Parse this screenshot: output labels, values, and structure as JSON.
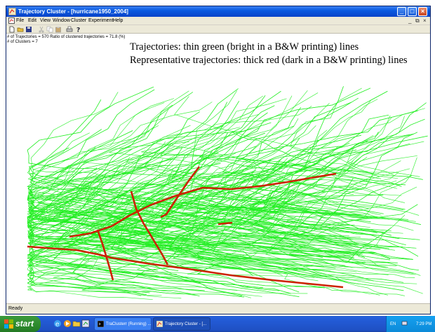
{
  "window": {
    "title": "Trajectory Cluster - [hurricane1950_2004]",
    "controls": {
      "minimize": "_",
      "maximize": "□",
      "close": "×"
    },
    "mdi_controls": [
      "_",
      "⧉",
      "×"
    ]
  },
  "menu": {
    "items": [
      "File",
      "Edit",
      "View",
      "Window",
      "Cluster",
      "Experiment",
      "Help"
    ]
  },
  "toolbar": {
    "buttons": [
      "new-icon",
      "open-icon",
      "save-icon",
      "cut-icon",
      "copy-icon",
      "paste-icon",
      "print-icon",
      "help-icon"
    ]
  },
  "canvas": {
    "stat_line_1": "# of Trajectories = 570    Ratio of clustered trajectories = 71.8 (%)",
    "stat_line_2": "# of Clusters = 7",
    "legend_line_1": "Trajectories: thin green (bright in a B&W printing) lines",
    "legend_line_2": "Representative trajectories: thick red (dark in a B&W printing) lines",
    "colors": {
      "trajectory": "#22ee22",
      "representative": "#cc2200"
    }
  },
  "status": {
    "text": "Ready"
  },
  "taskbar": {
    "start_label": "start",
    "quick_launch": [
      "ie-icon",
      "media-icon",
      "folder-icon",
      "app-icon"
    ],
    "tasks": [
      {
        "label": "TraClusterr (Running) ..."
      },
      {
        "label": "Trajectory Cluster - [..."
      }
    ],
    "tray": {
      "lang": "EN",
      "clock": "7:29 PM"
    }
  }
}
